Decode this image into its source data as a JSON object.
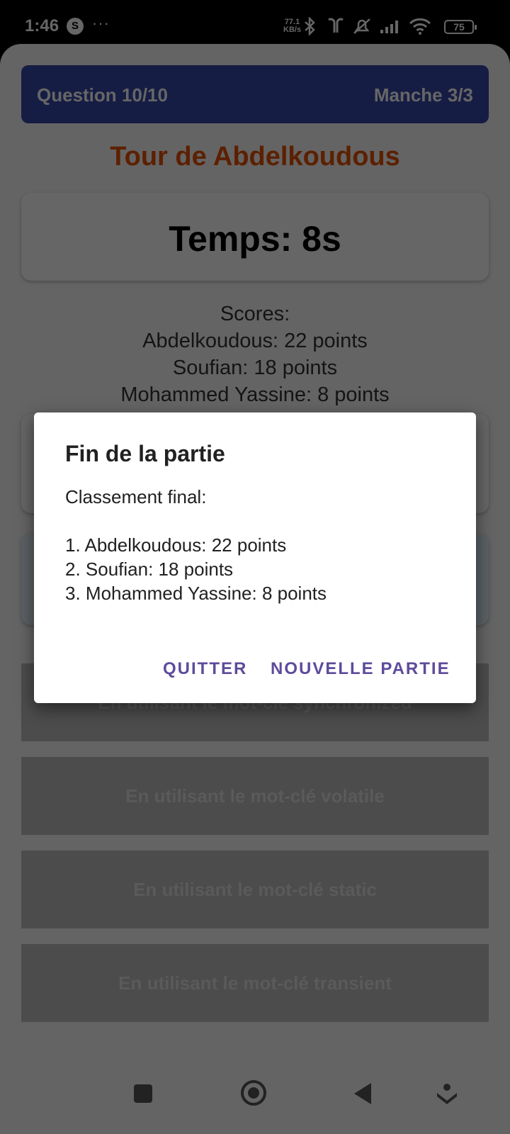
{
  "status_bar": {
    "time": "1:46",
    "app_badge": "S",
    "more": "···",
    "net_speed_value": "77.1",
    "net_speed_unit": "KB/s",
    "battery": "75",
    "icons": [
      "bluetooth-icon",
      "earbuds-icon",
      "silent-icon",
      "signal-icon",
      "wifi-icon",
      "battery-icon"
    ]
  },
  "header": {
    "question": "Question 10/10",
    "round": "Manche 3/3"
  },
  "turn": "Tour de Abdelkoudous",
  "timer": "Temps: 8s",
  "scores": {
    "title": "Scores:",
    "lines": [
      "Abdelkoudous: 22 points",
      "Soufian: 18 points",
      "Mohammed Yassine: 8 points"
    ]
  },
  "answers": [
    "En utilisant le mot-clé synchronized",
    "En utilisant le mot-clé volatile",
    "En utilisant le mot-clé static",
    "En utilisant le mot-clé transient"
  ],
  "dialog": {
    "title": "Fin de la partie",
    "heading": "Classement final:",
    "ranking": [
      "1. Abdelkoudous: 22 points",
      "2. Soufian: 18 points",
      "3. Mohammed Yassine: 8 points"
    ],
    "quit_label": "QUITTER",
    "new_game_label": "NOUVELLE PARTIE"
  },
  "colors": {
    "header_bg": "#3949ab",
    "turn_title": "#e65100",
    "dialog_button": "#5e4b9b"
  }
}
